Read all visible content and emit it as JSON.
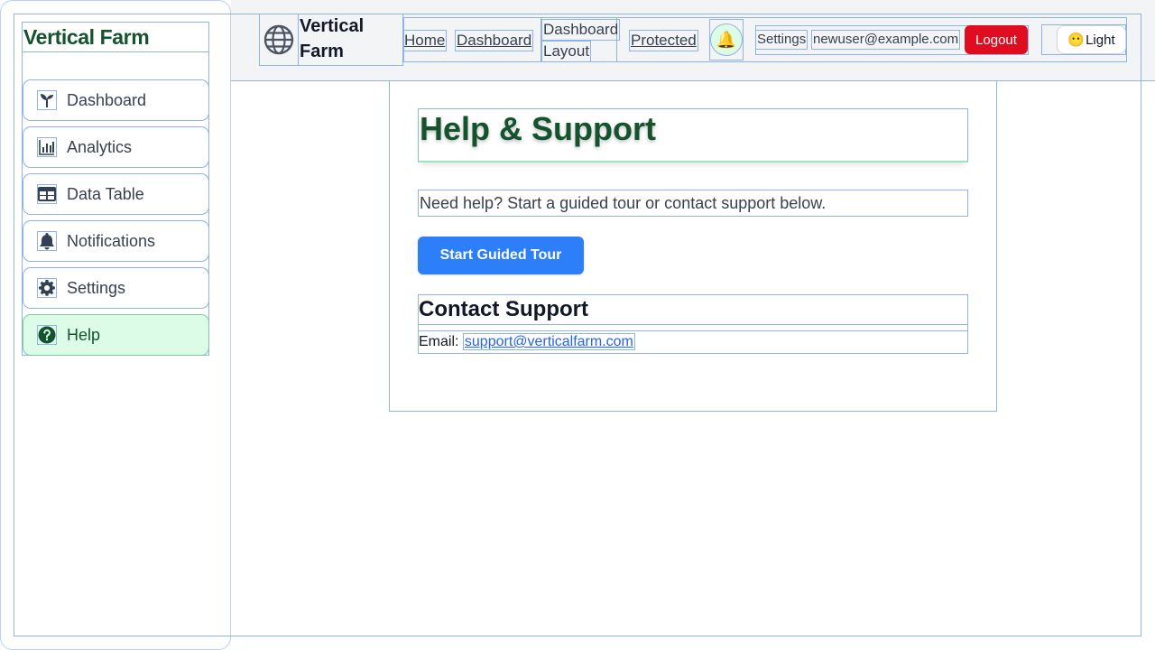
{
  "sidebar": {
    "brand": "Vertical Farm",
    "items": [
      {
        "label": "Dashboard",
        "icon": "seedling-icon",
        "active": false
      },
      {
        "label": "Analytics",
        "icon": "bar-chart-icon",
        "active": false
      },
      {
        "label": "Data Table",
        "icon": "table-icon",
        "active": false
      },
      {
        "label": "Notifications",
        "icon": "bell-icon",
        "active": false
      },
      {
        "label": "Settings",
        "icon": "gear-icon",
        "active": false
      },
      {
        "label": "Help",
        "icon": "question-icon",
        "active": true
      }
    ]
  },
  "header": {
    "logo_text": "Vertical Farm",
    "nav": {
      "home": "Home",
      "dashboard": "Dashboard",
      "dashboard_layout_line1": "Dashboard",
      "dashboard_layout_line2": "Layout",
      "protected": "Protected"
    },
    "notification_icon": "🔔",
    "settings": "Settings",
    "user_email": "newuser@example.com",
    "logout": "Logout",
    "theme_emoji": "😶",
    "theme_label": "Light"
  },
  "main": {
    "title": "Help & Support",
    "intro": "Need help? Start a guided tour or contact support below.",
    "tour_button": "Start Guided Tour",
    "contact_title": "Contact Support",
    "email_label": "Email:",
    "email_link": "support@verticalfarm.com"
  },
  "colors": {
    "brand_green": "#14532d",
    "active_bg": "#dcfce7",
    "primary_blue": "#2d7ff9",
    "logout_red": "#e00c1f"
  }
}
